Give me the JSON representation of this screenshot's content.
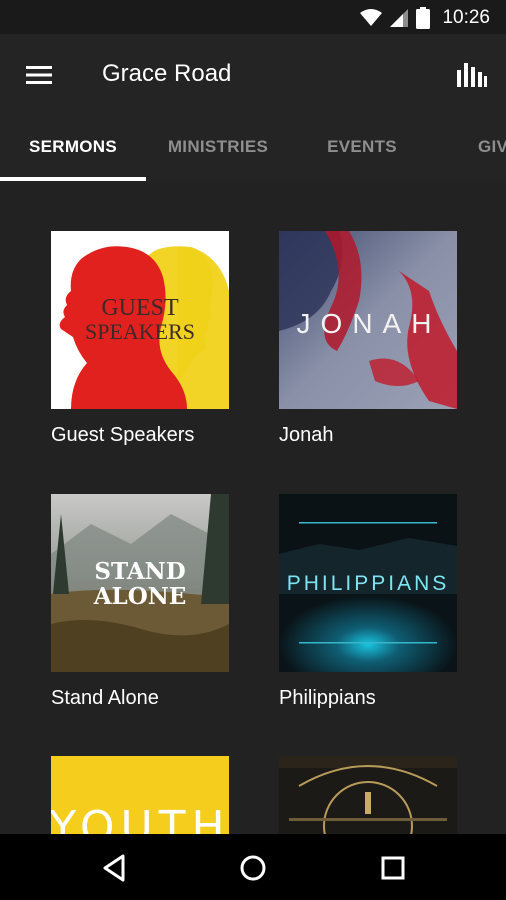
{
  "status_bar": {
    "time": "10:26",
    "icons": [
      "wifi-icon",
      "cell-signal-icon",
      "battery-icon"
    ]
  },
  "app_bar": {
    "title": "Grace Road",
    "left_icon": "menu-icon",
    "right_icon": "bar-chart-icon"
  },
  "tabs": [
    {
      "label": "SERMONS",
      "active": true
    },
    {
      "label": "MINISTRIES",
      "active": false
    },
    {
      "label": "EVENTS",
      "active": false
    },
    {
      "label": "GIVE",
      "active": false
    }
  ],
  "series": [
    {
      "title": "Guest Speakers",
      "art_text": [
        "GUEST",
        "SPEAKERS"
      ]
    },
    {
      "title": "Jonah",
      "art_text": [
        "JONAH"
      ]
    },
    {
      "title": "Stand Alone",
      "art_text": [
        "STAND",
        "ALONE"
      ]
    },
    {
      "title": "Philippians",
      "art_text": [
        "PHILIPPIANS"
      ]
    },
    {
      "title": "",
      "art_text": [
        "YOUTH"
      ]
    },
    {
      "title": "",
      "art_text": []
    }
  ],
  "nav_bar": {
    "icons": [
      "back-icon",
      "home-icon",
      "recents-icon"
    ]
  },
  "colors": {
    "background": "#222222",
    "app_bar": "#242424",
    "status_bar": "#1a1a1a",
    "active_tab": "#ffffff",
    "inactive_tab": "#8e8e8e"
  }
}
